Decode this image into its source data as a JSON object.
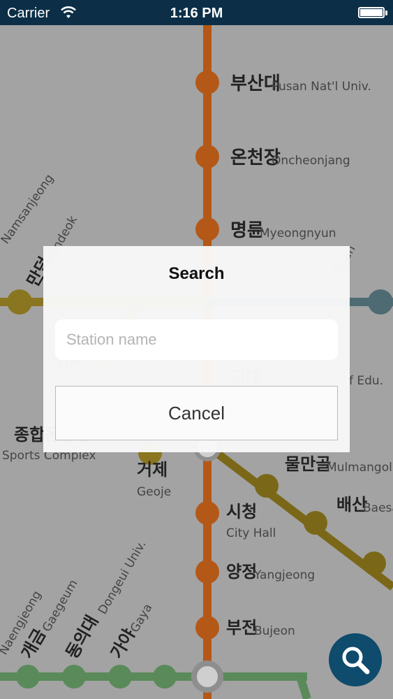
{
  "status_bar": {
    "carrier": "Carrier",
    "time": "1:16 PM",
    "icons": [
      "wifi-icon",
      "battery-icon"
    ]
  },
  "map": {
    "line_colors": {
      "line1": "#b45818",
      "line2": "#8a7520",
      "line3": "#7a6818",
      "line4": "#4e6a72",
      "line_green": "#5a8a5a"
    },
    "stations": [
      {
        "ko": "부산대",
        "en": "Pusan Nat'l Univ."
      },
      {
        "ko": "온천장",
        "en": "Oncheonjang"
      },
      {
        "ko": "명륜",
        "en": "Myeongnyun"
      },
      {
        "ko": "",
        "en": "Namsanjeong"
      },
      {
        "ko": "만덕",
        "en": "Mandeok"
      },
      {
        "ko": "",
        "en": "Suan"
      },
      {
        "ko": "서면",
        "en": ""
      },
      {
        "ko": "교대",
        "en": "f Edu."
      },
      {
        "ko": "종합운동장",
        "en": "Sports Complex"
      },
      {
        "ko": "거제",
        "en": "Geoje"
      },
      {
        "ko": "물만골",
        "en": "Mulmangol"
      },
      {
        "ko": "배산",
        "en": "Baesan"
      },
      {
        "ko": "시청",
        "en": "City Hall"
      },
      {
        "ko": "양정",
        "en": "Yangjeong"
      },
      {
        "ko": "부전",
        "en": "Bujeon"
      },
      {
        "ko": "",
        "en": "Naengjeong"
      },
      {
        "ko": "개금",
        "en": "Gaegeum"
      },
      {
        "ko": "동의대",
        "en": "Dongeui Univ."
      },
      {
        "ko": "가야",
        "en": "Gaya"
      }
    ]
  },
  "dialog": {
    "title": "Search",
    "input_value": "",
    "input_placeholder": "Station name",
    "cancel_label": "Cancel"
  },
  "fab": {
    "icon": "search-icon",
    "color": "#0e4b6c"
  }
}
